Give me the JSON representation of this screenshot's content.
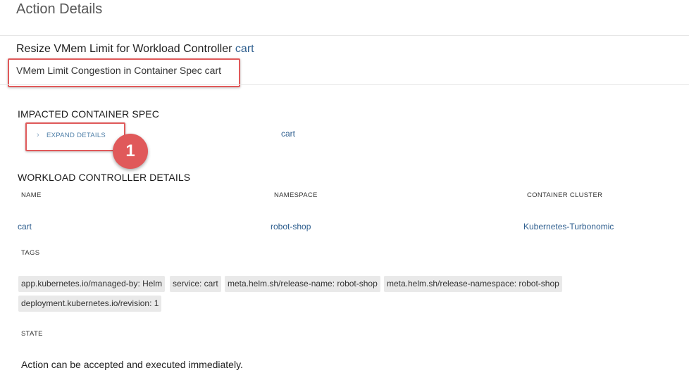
{
  "page": {
    "title": "Action Details"
  },
  "action": {
    "prefix": "Resize VMem Limit for Workload Controller",
    "target": "cart",
    "subtitle": "VMem Limit Congestion in Container Spec cart"
  },
  "impacted": {
    "heading": "IMPACTED CONTAINER SPEC",
    "expand_label": "EXPAND DETAILS",
    "spec_name": "cart"
  },
  "annotation": {
    "step": "1",
    "color": "#e0595a"
  },
  "workload": {
    "heading": "WORKLOAD CONTROLLER DETAILS",
    "columns": [
      {
        "label": "NAME",
        "value": "cart"
      },
      {
        "label": "NAMESPACE",
        "value": "robot-shop"
      },
      {
        "label": "CONTAINER CLUSTER",
        "value": "Kubernetes-Turbonomic"
      }
    ],
    "tags_label": "TAGS",
    "tags": [
      "app.kubernetes.io/managed-by: Helm",
      "service: cart",
      "meta.helm.sh/release-name: robot-shop",
      "meta.helm.sh/release-namespace: robot-shop",
      "deployment.kubernetes.io/revision: 1"
    ],
    "state_label": "STATE",
    "state_text": "Action can be accepted and executed immediately."
  },
  "colors": {
    "link": "#2f5f8f",
    "highlight": "#e0595a",
    "tag_bg": "#e9e9e9"
  },
  "icons": {
    "expand": "chevron-right-icon"
  }
}
